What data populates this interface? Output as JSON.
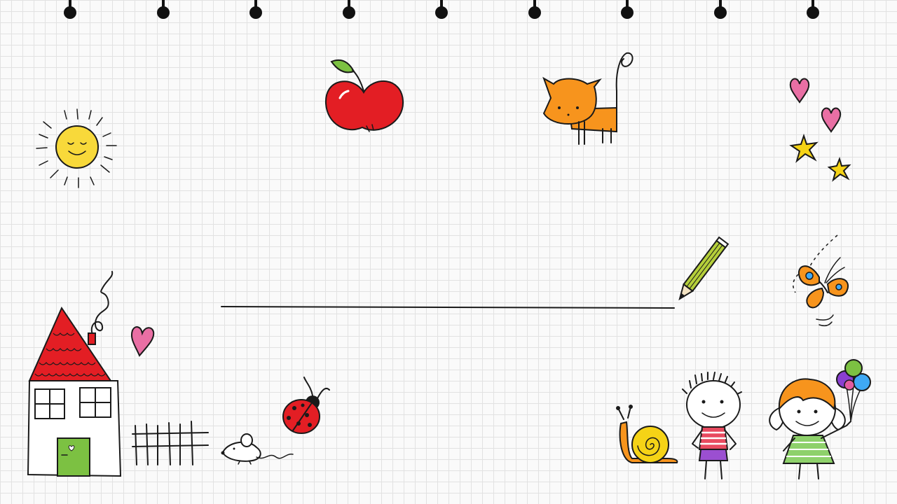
{
  "slide": {
    "background": "#fafafa",
    "grid_color": "#e2e2e2",
    "binder_rings": 9,
    "title": "",
    "subtitle": ""
  },
  "doodles": {
    "sun": "sun-icon",
    "apple": "apple-icon",
    "cat": "cat-icon",
    "hearts": "heart-icon",
    "stars": "star-icon",
    "pencil": "pencil-icon",
    "butterfly": "butterfly-icon",
    "house": "house-icon",
    "fence": "fence-icon",
    "mouse": "mouse-icon",
    "ladybug": "ladybug-icon",
    "snail": "snail-icon",
    "boy": "boy-icon",
    "girl": "girl-icon",
    "balloons": "balloons-icon"
  },
  "colors": {
    "sun": "#f8d93a",
    "apple": "#e31e24",
    "leaf": "#7cc142",
    "cat": "#f7941d",
    "heart": "#e96fa4",
    "star": "#f5d316",
    "pencil": "#b5cf3a",
    "butterfly": "#f7941d",
    "roof": "#e31e24",
    "door": "#7cc142",
    "snail": "#f5b800",
    "shirt": "#e84a5f",
    "shorts": "#9b4fd1",
    "dress": "#8ed16b",
    "hair": "#f7941d",
    "balloon_purple": "#8a3fd1",
    "balloon_blue": "#3fa9f5",
    "balloon_green": "#7cc142",
    "balloon_pink": "#e35ba0"
  }
}
